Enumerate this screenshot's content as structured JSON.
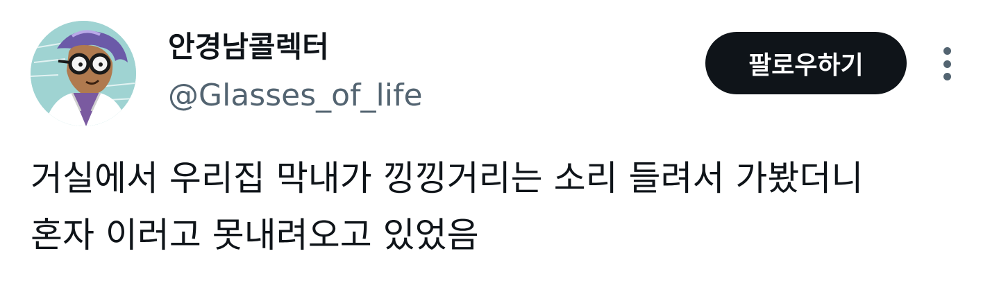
{
  "user": {
    "display_name": "안경남콜렉터",
    "handle": "@Glasses_of_life",
    "avatar_icon": "profile-avatar-icon"
  },
  "actions": {
    "follow_label": "팔로우하기",
    "more_icon": "more-options-icon"
  },
  "tweet": {
    "lines": [
      "거실에서 우리집 막내가 낑낑거리는 소리 들려서 가봤더니",
      "혼자 이러고 못내려오고 있었음"
    ]
  },
  "colors": {
    "text_primary": "#0f1419",
    "text_secondary": "#536471",
    "button_bg": "#0f1419",
    "button_text": "#ffffff"
  }
}
